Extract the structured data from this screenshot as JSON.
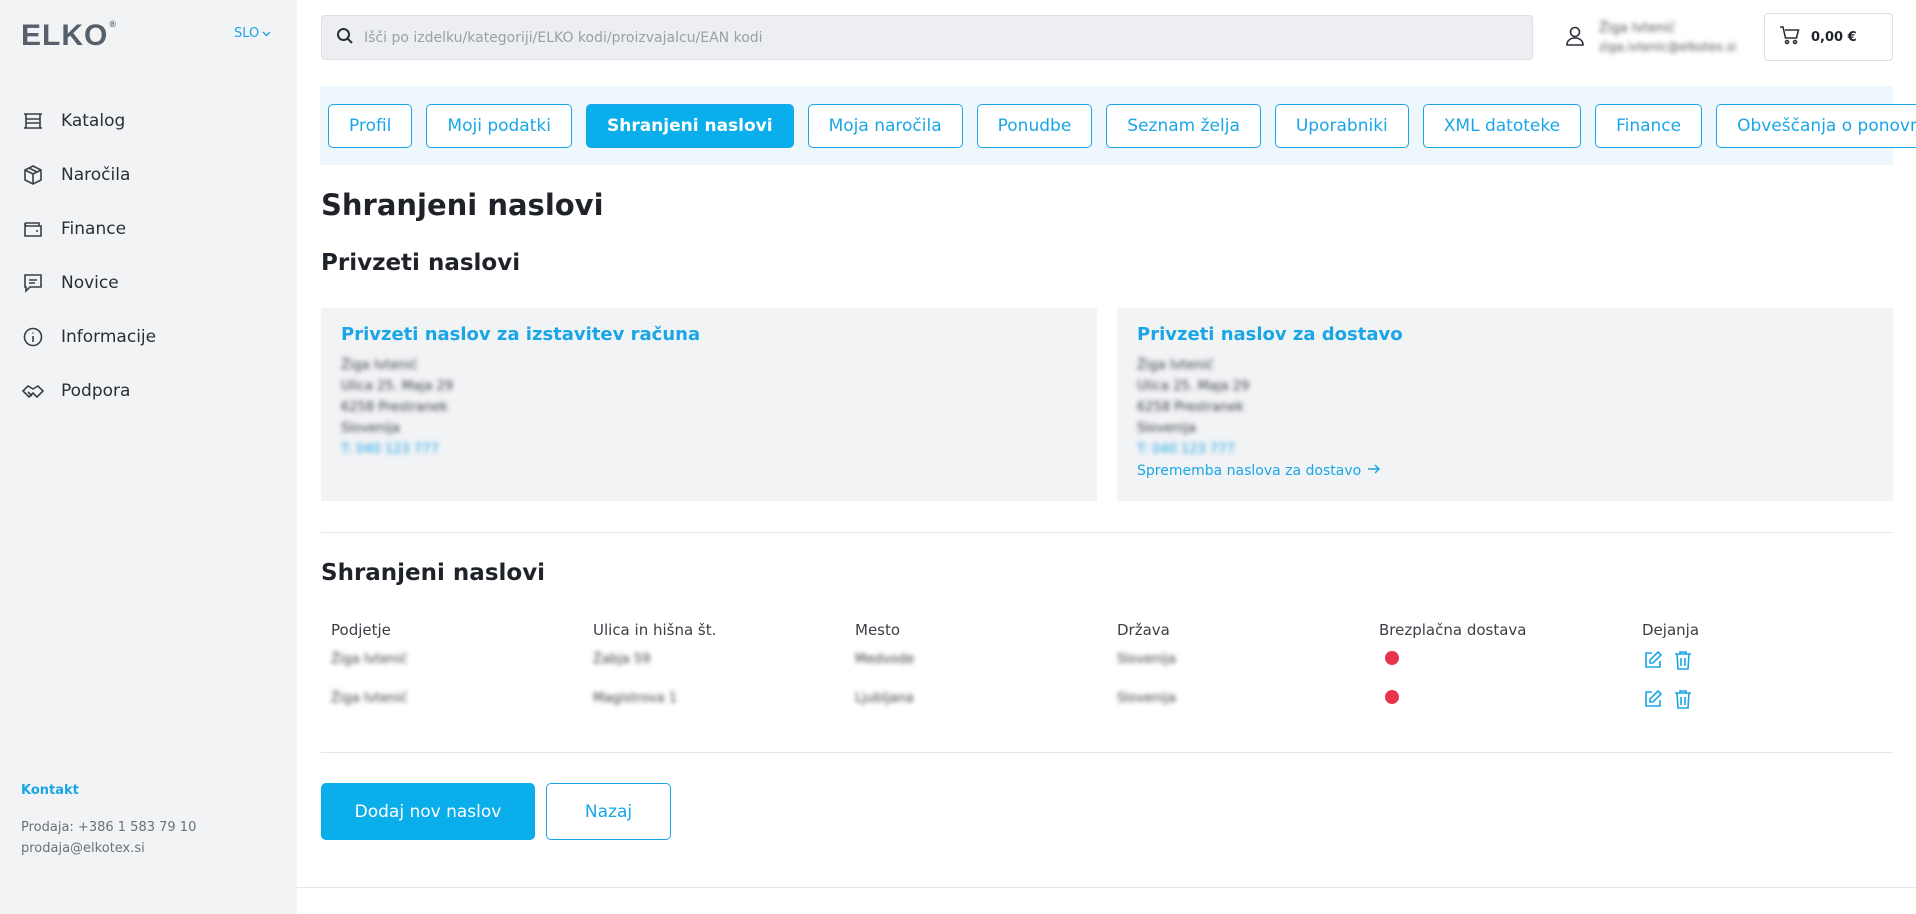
{
  "brand": {
    "logo": "ELKO",
    "accent": "#1aa6e6",
    "primary_button": "#0aaeea",
    "status_red": "#e8344e"
  },
  "lang": {
    "label": "SLO"
  },
  "sidebar": {
    "items": [
      {
        "label": "Katalog",
        "icon": "catalog-icon"
      },
      {
        "label": "Naročila",
        "icon": "box-icon"
      },
      {
        "label": "Finance",
        "icon": "wallet-icon"
      },
      {
        "label": "Novice",
        "icon": "message-icon"
      },
      {
        "label": "Informacije",
        "icon": "info-icon"
      },
      {
        "label": "Podpora",
        "icon": "handshake-icon"
      }
    ],
    "contact": {
      "title": "Kontakt",
      "phone": "Prodaja: +386 1 583 79 10",
      "email": "prodaja@elkotex.si"
    }
  },
  "search": {
    "placeholder": "Išči po izdelku/kategoriji/ELKO kodi/proizvajalcu/EAN kodi"
  },
  "user": {
    "name": "Žiga Ivtenić",
    "email": "ziga.ivtenic@elkotex.si"
  },
  "cart": {
    "total": "0,00 €"
  },
  "tabs": [
    {
      "label": "Profil"
    },
    {
      "label": "Moji podatki"
    },
    {
      "label": "Shranjeni naslovi",
      "active": true
    },
    {
      "label": "Moja naročila"
    },
    {
      "label": "Ponudbe"
    },
    {
      "label": "Seznam želja"
    },
    {
      "label": "Uporabniki"
    },
    {
      "label": "XML datoteke"
    },
    {
      "label": "Finance"
    },
    {
      "label": "Obveščanja o ponovni zalogi"
    }
  ],
  "page": {
    "title": "Shranjeni naslovi",
    "default_section_title": "Privzeti naslovi",
    "billing": {
      "title": "Privzeti naslov za izstavitev računa",
      "lines": [
        "Žiga Ivtenić",
        "Ulica 25. Maja 29",
        "6258 Prestranek",
        "Slovenija"
      ],
      "phone": "T: 040 123 777"
    },
    "shipping": {
      "title": "Privzeti naslov za dostavo",
      "lines": [
        "Žiga Ivtenić",
        "Ulica 25. Maja 29",
        "6258 Prestranek",
        "Slovenija"
      ],
      "phone": "T: 040 123 777",
      "change_link": "Sprememba naslova za dostavo"
    },
    "saved_section_title": "Shranjeni naslovi",
    "table": {
      "headers": [
        "Podjetje",
        "Ulica in hišna št.",
        "Mesto",
        "Država",
        "Brezplačna dostava",
        "Dejanja"
      ],
      "rows": [
        {
          "company": "Žiga Ivtenić",
          "street": "Žabja 59",
          "city": "Medvode",
          "country": "Slovenija",
          "free_delivery": false
        },
        {
          "company": "Žiga Ivtenić",
          "street": "Magistrova 1",
          "city": "Ljubljana",
          "country": "Slovenija",
          "free_delivery": false
        }
      ]
    },
    "add_button": "Dodaj nov naslov",
    "back_button": "Nazaj"
  }
}
